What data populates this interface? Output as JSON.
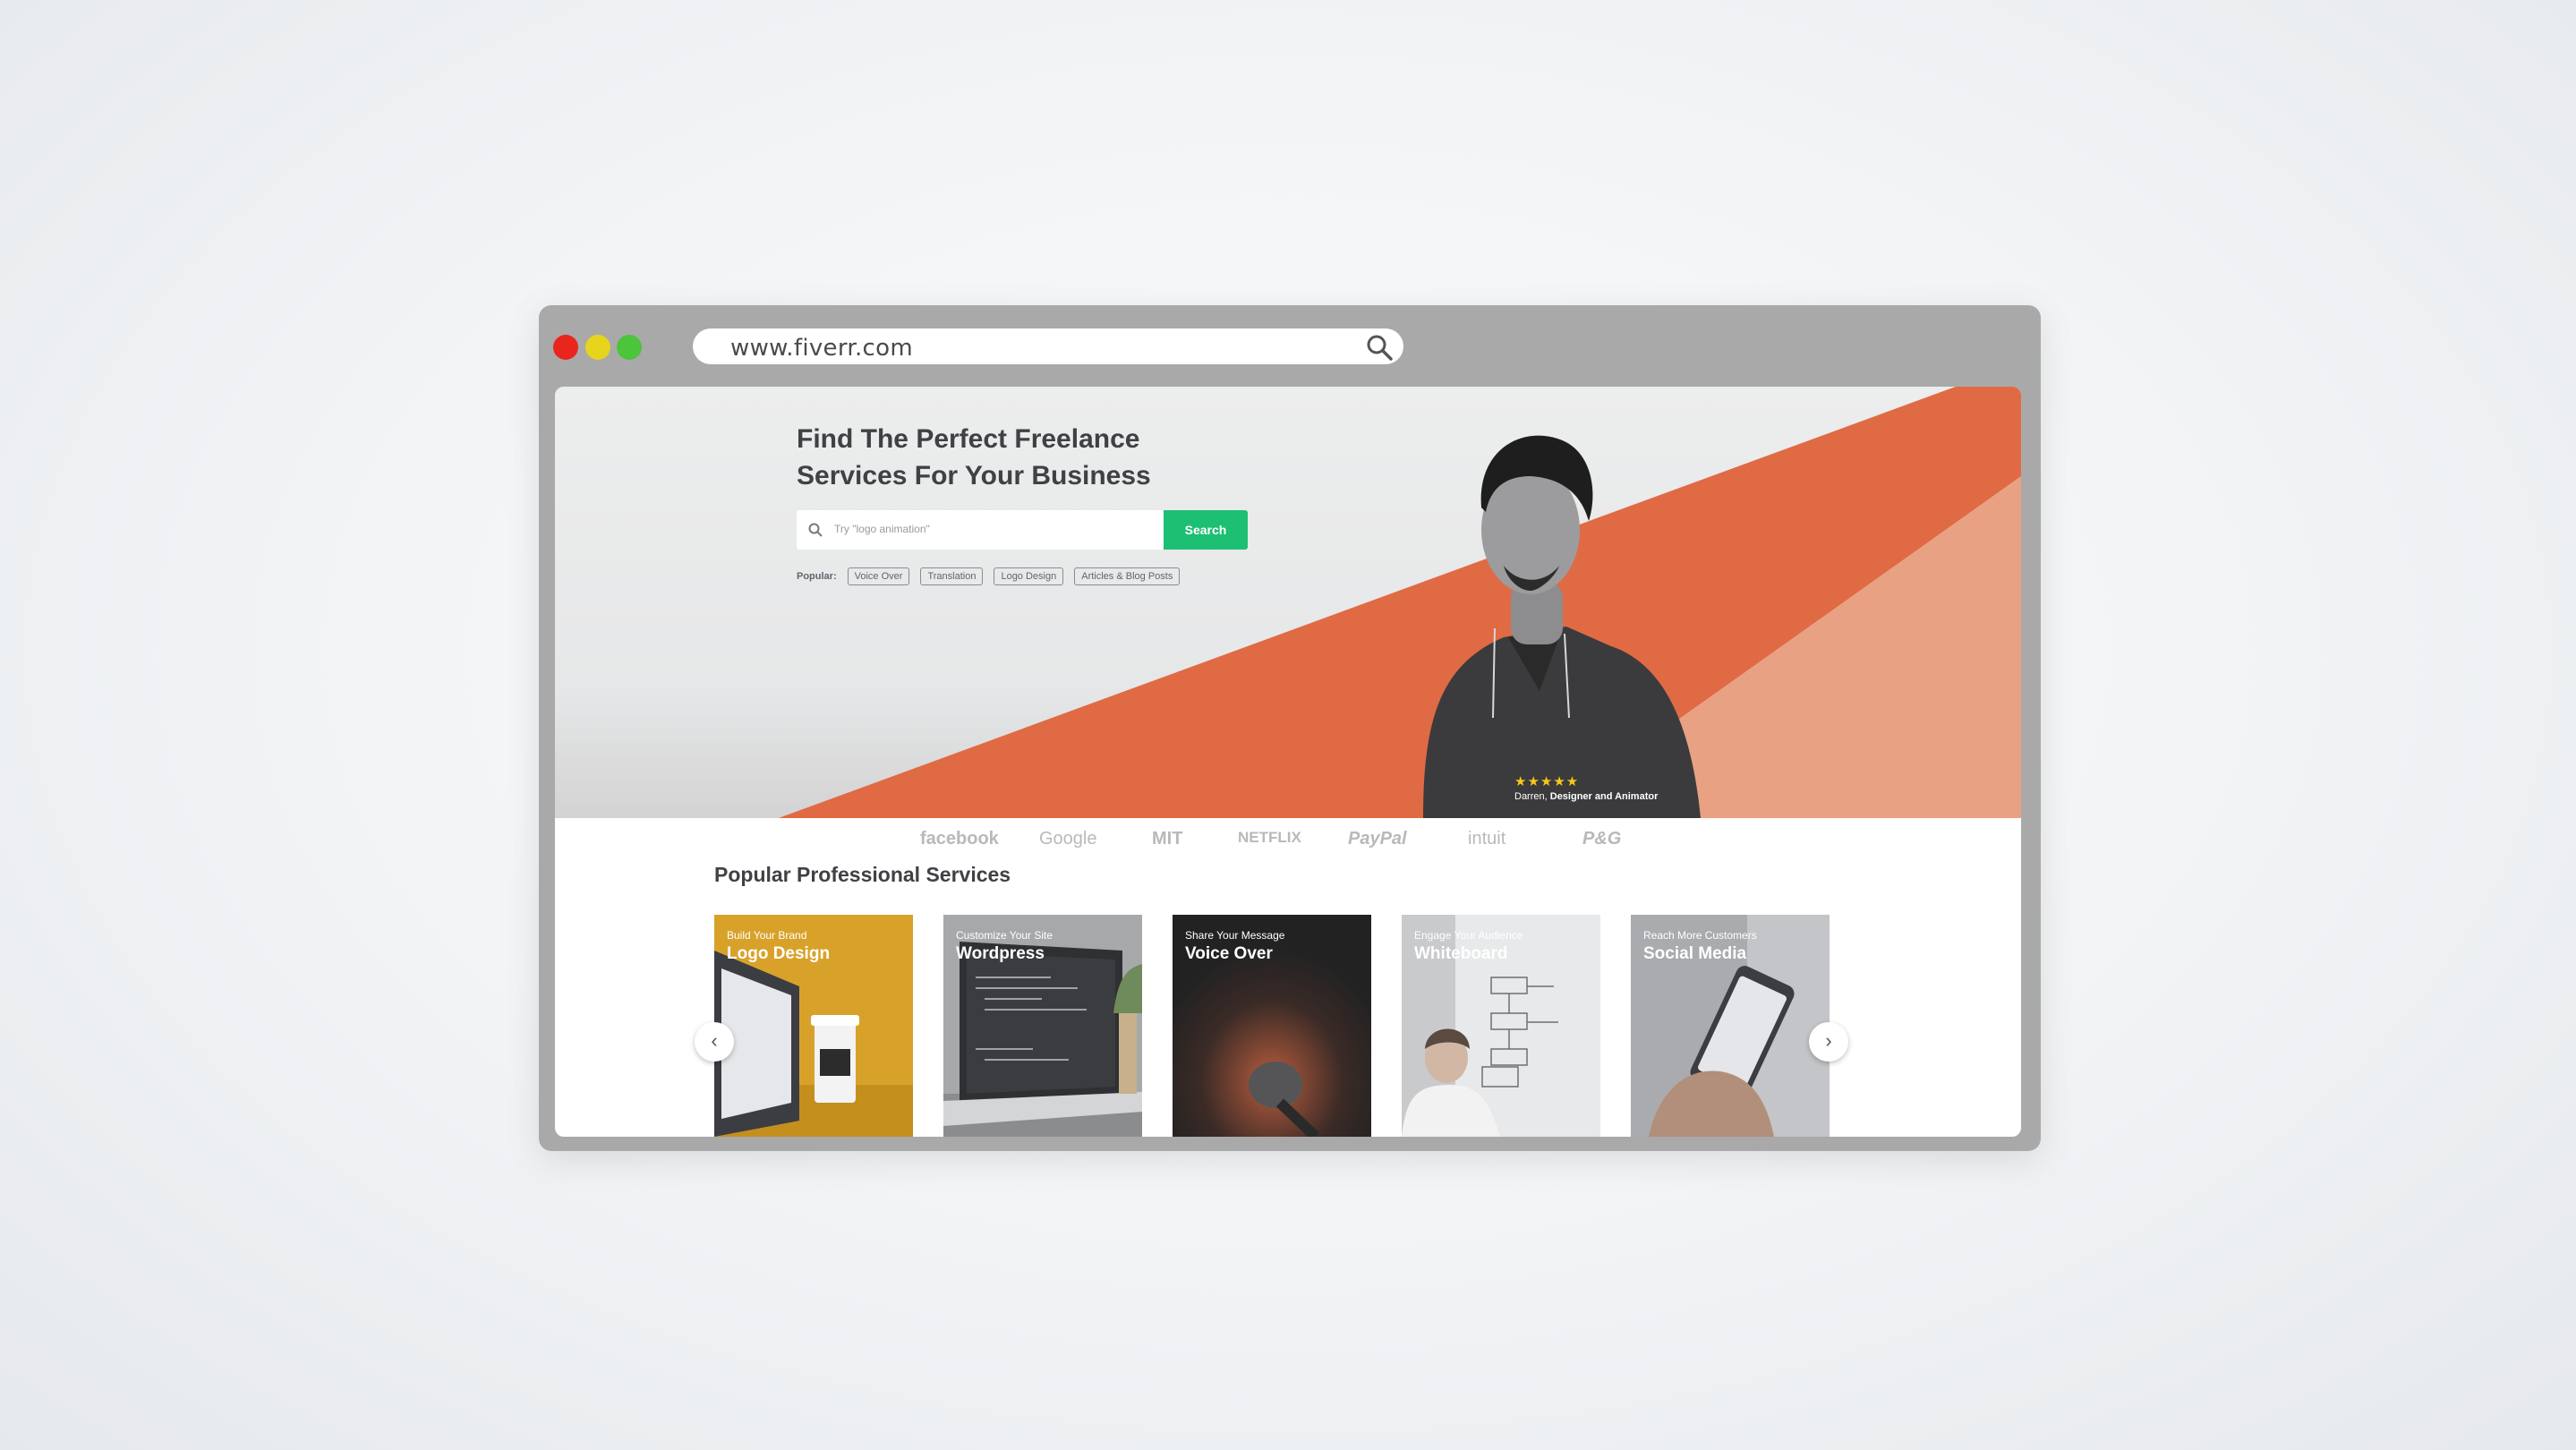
{
  "browser": {
    "url": "www.fiverr.com",
    "search_icon": "search-icon"
  },
  "hero": {
    "title_line1": "Find The Perfect Freelance",
    "title_line2": "Services For Your Business",
    "search_placeholder": "Try \"logo animation\"",
    "search_button": "Search",
    "popular_label": "Popular:",
    "popular_tags": [
      "Voice Over",
      "Translation",
      "Logo Design",
      "Articles & Blog Posts"
    ],
    "rating_stars": "★★★★★",
    "credit_name": "Darren,",
    "credit_role": "Designer and Animator",
    "colors": {
      "accent_dark": "#e0653f",
      "accent_light": "#e99b7c",
      "button": "#1dbf73"
    }
  },
  "trusted_by": [
    "facebook",
    "Google",
    "MIT",
    "NETFLIX",
    "PayPal",
    "intuit",
    "P&G"
  ],
  "services": {
    "title": "Popular Professional Services",
    "cards": [
      {
        "subtitle": "Build Your Brand",
        "title": "Logo Design"
      },
      {
        "subtitle": "Customize Your Site",
        "title": "Wordpress"
      },
      {
        "subtitle": "Share Your Message",
        "title": "Voice Over"
      },
      {
        "subtitle": "Engage Your Audience",
        "title": "Whiteboard"
      },
      {
        "subtitle": "Reach More Customers",
        "title": "Social Media"
      }
    ],
    "prev_arrow": "‹",
    "next_arrow": "›"
  }
}
